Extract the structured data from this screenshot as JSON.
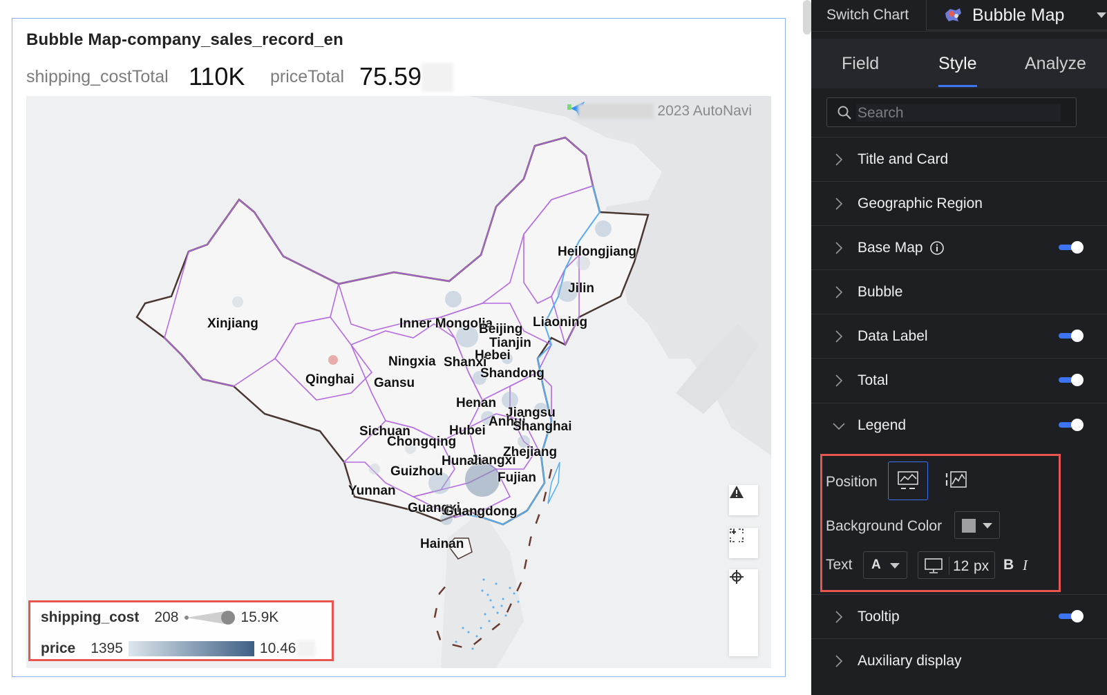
{
  "chart": {
    "title": "Bubble Map-company_sales_record_en",
    "totals": [
      {
        "label": "shipping_costTotal",
        "value": "110K"
      },
      {
        "label": "priceTotal",
        "value": "75.59"
      }
    ],
    "attribution": "2023 AutoNavi",
    "provinces": [
      "Heilongjiang",
      "Jilin",
      "Liaoning",
      "Inner Mongolia",
      "Beijing",
      "Tianjin",
      "Hebei",
      "Xinjiang",
      "Ningxia",
      "Shanxi",
      "Shandong",
      "Qinghai",
      "Gansu",
      "Henan",
      "Jiangsu",
      "Anhui",
      "Shanghai",
      "Sichuan",
      "Hubei",
      "Chongqing",
      "Zhejiang",
      "Hunan",
      "Jiangxi",
      "Guizhou",
      "Fujian",
      "Yunnan",
      "Guangxi",
      "Guangdong",
      "Hainan"
    ],
    "legend": {
      "size": {
        "name": "shipping_cost",
        "min": "208",
        "max": "15.9K"
      },
      "color": {
        "name": "price",
        "min": "1395",
        "max": "10.46",
        "from_color": "#dde6ec",
        "to_color": "#3e5f85"
      }
    },
    "map_controls": [
      "warning-icon",
      "fullscreen-icon",
      "zoom-in-icon",
      "locate-icon",
      "zoom-out-icon"
    ]
  },
  "panel": {
    "switch_chart_label": "Switch Chart",
    "chart_type": "Bubble Map",
    "tabs": [
      "Field",
      "Style",
      "Analyze"
    ],
    "active_tab": "Style",
    "search_placeholder": "Search",
    "sections": [
      {
        "label": "Title and Card",
        "toggle": false
      },
      {
        "label": "Geographic Region",
        "toggle": false
      },
      {
        "label": "Base Map",
        "toggle": true,
        "info": true
      },
      {
        "label": "Bubble",
        "toggle": false
      },
      {
        "label": "Data Label",
        "toggle": true
      },
      {
        "label": "Total",
        "toggle": true
      },
      {
        "label": "Legend",
        "toggle": true,
        "expanded": true
      },
      {
        "label": "Tooltip",
        "toggle": true
      },
      {
        "label": "Auxiliary display",
        "toggle": false
      }
    ],
    "legend_settings": {
      "position_label": "Position",
      "background_color_label": "Background Color",
      "background_color": "#9e9ea3",
      "text_label": "Text",
      "font_color_letter": "A",
      "font_size": "12",
      "font_unit": "px",
      "bold": "B",
      "italic": "I"
    },
    "accent_color": "#3d74f2"
  }
}
